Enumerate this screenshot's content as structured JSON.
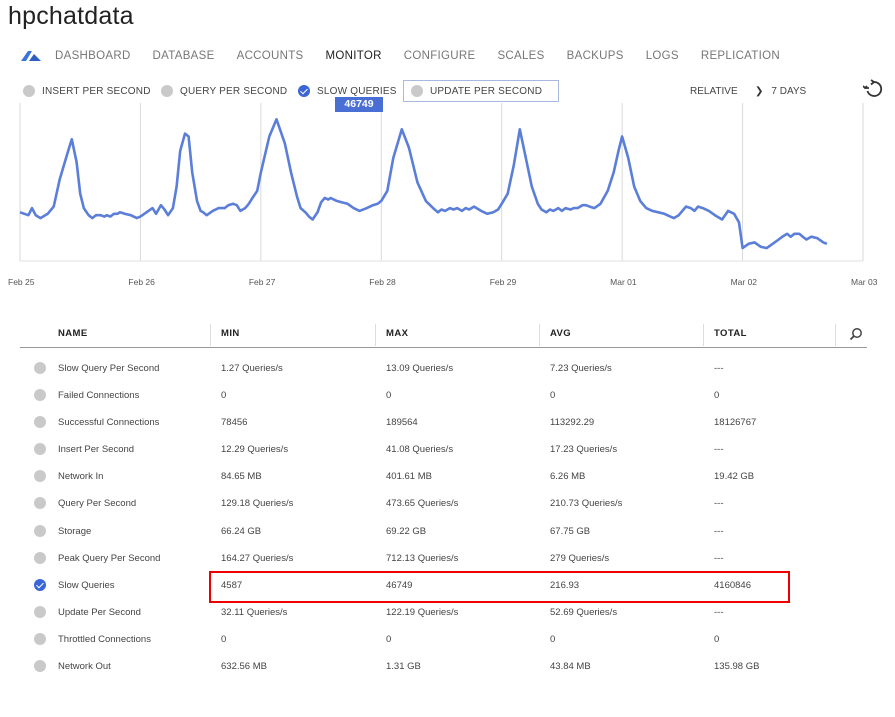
{
  "app": {
    "title": "hpchatdata"
  },
  "nav": {
    "logo_icon": "azure-logo-icon",
    "items": [
      {
        "label": "DASHBOARD"
      },
      {
        "label": "DATABASE"
      },
      {
        "label": "ACCOUNTS"
      },
      {
        "label": "MONITOR",
        "active": true
      },
      {
        "label": "CONFIGURE"
      },
      {
        "label": "SCALES"
      },
      {
        "label": "BACKUPS"
      },
      {
        "label": "LOGS"
      },
      {
        "label": "REPLICATION"
      }
    ]
  },
  "filters": {
    "metrics": [
      {
        "label": "INSERT PER SECOND",
        "checked": false
      },
      {
        "label": "QUERY PER SECOND",
        "checked": false
      },
      {
        "label": "SLOW QUERIES",
        "checked": true
      },
      {
        "label": "UPDATE PER SECOND",
        "checked": false
      }
    ],
    "mode": "RELATIVE",
    "range": "7 DAYS",
    "refresh_icon": "refresh-icon"
  },
  "chart_data": {
    "type": "line",
    "series": [
      {
        "name": "SLOW QUERIES",
        "color": "#5b7ed9"
      }
    ],
    "x_ticks": [
      "Feb 25",
      "Feb 26",
      "Feb 27",
      "Feb 28",
      "Feb 29",
      "Mar 01",
      "Mar 02",
      "Mar 03"
    ],
    "tooltip": "46749",
    "grid": "vertical",
    "y_axis_labels": "none",
    "x": [
      0.0,
      0.07,
      0.1,
      0.13,
      0.17,
      0.23,
      0.28,
      0.33,
      0.4,
      0.43,
      0.47,
      0.5,
      0.53,
      0.57,
      0.6,
      0.63,
      0.67,
      0.7,
      0.72,
      0.75,
      0.78,
      0.81,
      0.83,
      0.87,
      0.92,
      0.97,
      1.0,
      1.05,
      1.1,
      1.13,
      1.17,
      1.2,
      1.23,
      1.27,
      1.3,
      1.33,
      1.37,
      1.4,
      1.43,
      1.47,
      1.5,
      1.52,
      1.55,
      1.6,
      1.65,
      1.7,
      1.73,
      1.77,
      1.8,
      1.83,
      1.87,
      1.9,
      1.93,
      1.97,
      2.0,
      2.07,
      2.13,
      2.2,
      2.25,
      2.3,
      2.33,
      2.37,
      2.4,
      2.43,
      2.47,
      2.5,
      2.53,
      2.56,
      2.58,
      2.63,
      2.67,
      2.72,
      2.77,
      2.82,
      2.88,
      2.93,
      2.97,
      3.0,
      3.05,
      3.1,
      3.17,
      3.23,
      3.3,
      3.37,
      3.43,
      3.47,
      3.5,
      3.53,
      3.57,
      3.6,
      3.63,
      3.67,
      3.7,
      3.73,
      3.77,
      3.83,
      3.88,
      3.93,
      3.97,
      4.0,
      4.05,
      4.1,
      4.15,
      4.2,
      4.25,
      4.3,
      4.33,
      4.37,
      4.4,
      4.43,
      4.47,
      4.5,
      4.53,
      4.57,
      4.6,
      4.63,
      4.67,
      4.7,
      4.73,
      4.77,
      4.82,
      4.88,
      4.93,
      4.97,
      5.0,
      5.05,
      5.1,
      5.15,
      5.2,
      5.25,
      5.3,
      5.35,
      5.4,
      5.43,
      5.47,
      5.5,
      5.53,
      5.57,
      5.6,
      5.63,
      5.67,
      5.72,
      5.77,
      5.83,
      5.88,
      5.93,
      5.97,
      6.0,
      6.05,
      6.1,
      6.15,
      6.2,
      6.25,
      6.3,
      6.33,
      6.37,
      6.4,
      6.43,
      6.47,
      6.5,
      6.53,
      6.57,
      6.62,
      6.67,
      6.7
    ],
    "values": [
      0.27,
      0.25,
      0.3,
      0.25,
      0.23,
      0.26,
      0.31,
      0.5,
      0.7,
      0.78,
      0.62,
      0.4,
      0.3,
      0.25,
      0.23,
      0.25,
      0.25,
      0.24,
      0.25,
      0.24,
      0.26,
      0.26,
      0.27,
      0.26,
      0.25,
      0.23,
      0.24,
      0.27,
      0.3,
      0.26,
      0.32,
      0.29,
      0.25,
      0.3,
      0.45,
      0.7,
      0.82,
      0.8,
      0.55,
      0.35,
      0.28,
      0.27,
      0.25,
      0.28,
      0.3,
      0.3,
      0.32,
      0.33,
      0.32,
      0.28,
      0.3,
      0.33,
      0.37,
      0.42,
      0.55,
      0.8,
      0.92,
      0.75,
      0.55,
      0.38,
      0.3,
      0.27,
      0.24,
      0.22,
      0.27,
      0.34,
      0.37,
      0.36,
      0.37,
      0.35,
      0.34,
      0.33,
      0.3,
      0.28,
      0.3,
      0.32,
      0.33,
      0.35,
      0.42,
      0.65,
      0.85,
      0.72,
      0.48,
      0.35,
      0.3,
      0.27,
      0.29,
      0.28,
      0.3,
      0.29,
      0.3,
      0.28,
      0.3,
      0.29,
      0.31,
      0.28,
      0.26,
      0.27,
      0.29,
      0.33,
      0.4,
      0.6,
      0.85,
      0.65,
      0.45,
      0.33,
      0.29,
      0.27,
      0.29,
      0.28,
      0.3,
      0.28,
      0.3,
      0.29,
      0.3,
      0.3,
      0.32,
      0.32,
      0.31,
      0.3,
      0.33,
      0.42,
      0.55,
      0.7,
      0.8,
      0.65,
      0.45,
      0.35,
      0.3,
      0.28,
      0.27,
      0.26,
      0.24,
      0.23,
      0.25,
      0.28,
      0.31,
      0.3,
      0.28,
      0.31,
      0.3,
      0.28,
      0.25,
      0.22,
      0.28,
      0.26,
      0.2,
      0.02,
      0.05,
      0.06,
      0.03,
      0.02,
      0.05,
      0.08,
      0.1,
      0.12,
      0.1,
      0.12,
      0.12,
      0.1,
      0.08,
      0.1,
      0.09,
      0.06,
      0.05
    ]
  },
  "table": {
    "columns": [
      "NAME",
      "MIN",
      "MAX",
      "AVG",
      "TOTAL"
    ],
    "search_icon": "search-icon",
    "rows": [
      {
        "name": "Slow Query Per Second",
        "min": "1.27 Queries/s",
        "max": "13.09 Queries/s",
        "avg": "7.23 Queries/s",
        "total": "---",
        "checked": false
      },
      {
        "name": "Failed Connections",
        "min": "0",
        "max": "0",
        "avg": "0",
        "total": "0",
        "checked": false
      },
      {
        "name": "Successful Connections",
        "min": "78456",
        "max": "189564",
        "avg": "113292.29",
        "total": "18126767",
        "checked": false
      },
      {
        "name": "Insert Per Second",
        "min": "12.29 Queries/s",
        "max": "41.08 Queries/s",
        "avg": "17.23 Queries/s",
        "total": "---",
        "checked": false
      },
      {
        "name": "Network In",
        "min": "84.65 MB",
        "max": "401.61 MB",
        "avg": "6.26 MB",
        "total": "19.42 GB",
        "checked": false
      },
      {
        "name": "Query Per Second",
        "min": "129.18 Queries/s",
        "max": "473.65 Queries/s",
        "avg": "210.73 Queries/s",
        "total": "---",
        "checked": false
      },
      {
        "name": "Storage",
        "min": "66.24 GB",
        "max": "69.22 GB",
        "avg": "67.75 GB",
        "total": "---",
        "checked": false
      },
      {
        "name": "Peak Query Per Second",
        "min": "164.27 Queries/s",
        "max": "712.13 Queries/s",
        "avg": "279 Queries/s",
        "total": "---",
        "checked": false
      },
      {
        "name": "Slow Queries",
        "min": "4587",
        "max": "46749",
        "avg": "216.93",
        "total": "4160846",
        "checked": true,
        "highlighted": true
      },
      {
        "name": "Update Per Second",
        "min": "32.11 Queries/s",
        "max": "122.19 Queries/s",
        "avg": "52.69 Queries/s",
        "total": "---",
        "checked": false
      },
      {
        "name": "Throttled Connections",
        "min": "0",
        "max": "0",
        "avg": "0",
        "total": "0",
        "checked": false
      },
      {
        "name": "Network Out",
        "min": "632.56 MB",
        "max": "1.31 GB",
        "avg": "43.84 MB",
        "total": "135.98 GB",
        "checked": false
      }
    ]
  },
  "colors": {
    "accent": "#3a66d6",
    "line": "#5b7ed9",
    "highlight_border": "#e00000"
  }
}
